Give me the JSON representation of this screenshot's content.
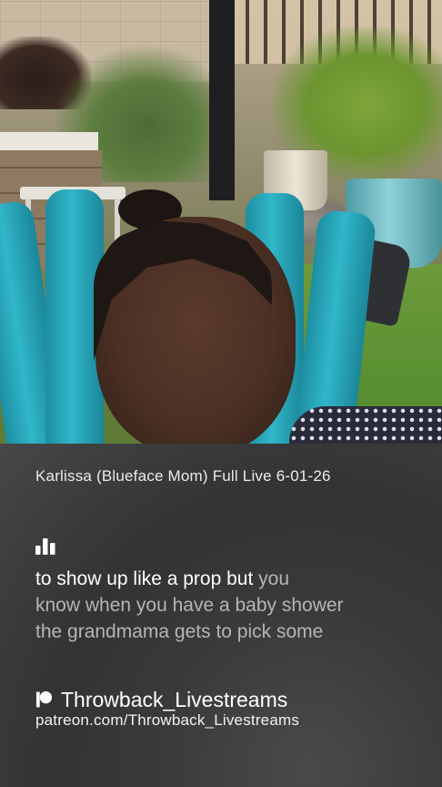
{
  "video": {
    "description_icon": "video-frame"
  },
  "panel": {
    "title": "Karlissa (Blueface Mom) Full Live 6-01-26",
    "caption_icon": "bar-chart-icon",
    "caption": {
      "line1_spoken": "to show up like a prop but",
      "line1_rest": " you",
      "line2": "know when you have a baby shower",
      "line3": "the grandmama gets to pick some"
    },
    "brand_icon": "patreon-icon",
    "brand_name": "Throwback_Livestreams",
    "brand_url": "patreon.com/Throwback_Livestreams"
  },
  "colors": {
    "panel_bg": "#3a3a3a",
    "caption_spoken": "#ffffff",
    "caption_upcoming": "#b5b5b5",
    "chair_teal": "#31b6c9"
  }
}
